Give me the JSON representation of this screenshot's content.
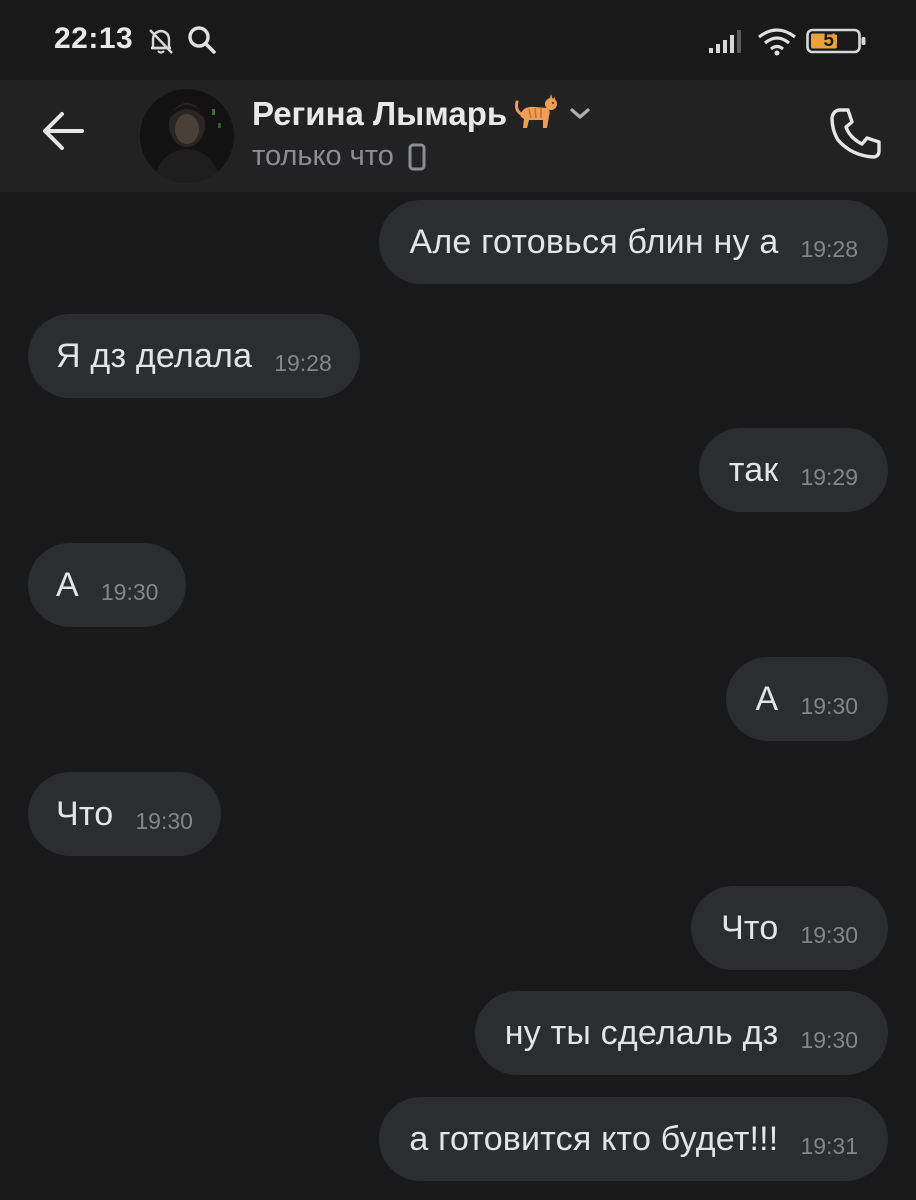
{
  "status_bar": {
    "time": "22:13",
    "battery_level": "57",
    "icons": [
      "bell-off-icon",
      "search-icon",
      "signal-icon",
      "wifi-icon",
      "battery-icon"
    ]
  },
  "header": {
    "contact_name": "Регина Лымарь",
    "contact_emoji": "cat-icon",
    "contact_status": "только что",
    "status_device_icon": "phone-icon",
    "back_icon": "back-arrow-icon",
    "call_icon": "phone-call-icon"
  },
  "colors": {
    "background": "#19191a",
    "header_background": "#222223",
    "bubble": "#2c2d2e",
    "text": "#e3e4e6",
    "secondary_text": "#8c8d91",
    "battery_fill": "#e8a33a"
  },
  "messages": [
    {
      "direction": "out",
      "text": "Але готовься блин ну а",
      "time": "19:28"
    },
    {
      "direction": "in",
      "text": "Я дз делала",
      "time": "19:28"
    },
    {
      "direction": "out",
      "text": "так",
      "time": "19:29"
    },
    {
      "direction": "in",
      "text": "А",
      "time": "19:30"
    },
    {
      "direction": "out",
      "text": "А",
      "time": "19:30"
    },
    {
      "direction": "in",
      "text": "Что",
      "time": "19:30"
    },
    {
      "direction": "out",
      "text": "Что",
      "time": "19:30"
    },
    {
      "direction": "out",
      "text": "ну ты сделаль дз",
      "time": "19:30"
    },
    {
      "direction": "out",
      "text": "а готовится кто будет!!!",
      "time": "19:31"
    }
  ]
}
